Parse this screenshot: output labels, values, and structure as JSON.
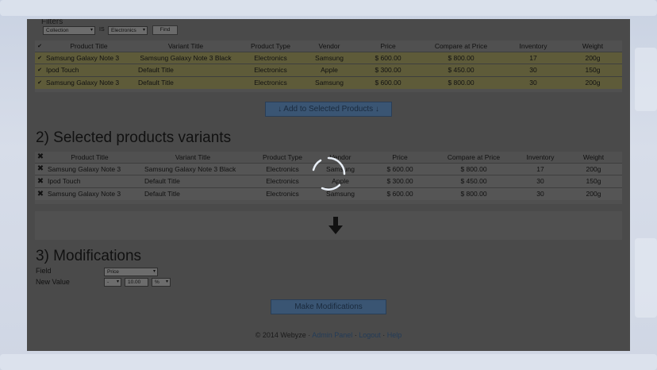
{
  "filters": {
    "label": "Filters",
    "field_value": "Collection",
    "operator": "IS",
    "value_value": "Electronics",
    "find_label": "Find"
  },
  "search_results": {
    "headers": [
      "Product Title",
      "Variant Title",
      "Product Type",
      "Vendor",
      "Price",
      "Compare at Price",
      "Inventory",
      "Weight"
    ],
    "rows": [
      [
        "Samsung Galaxy Note 3",
        "Samsung Galaxy Note 3 Black",
        "Electronics",
        "Samsung",
        "$ 600.00",
        "$ 800.00",
        "17",
        "200g"
      ],
      [
        "Ipod Touch",
        "Default Title",
        "Electronics",
        "Apple",
        "$ 300.00",
        "$ 450.00",
        "30",
        "150g"
      ],
      [
        "Samsung Galaxy Note 3",
        "Default Title",
        "Electronics",
        "Samsung",
        "$ 600.00",
        "$ 800.00",
        "30",
        "200g"
      ]
    ]
  },
  "add_button_label": "↓ Add to Selected Products ↓",
  "section2": {
    "title": "2) Selected products variants",
    "headers": [
      "Product Title",
      "Variant Title",
      "Product Type",
      "Vendor",
      "Price",
      "Compare at Price",
      "Inventory",
      "Weight"
    ],
    "rows": [
      [
        "Samsung Galaxy Note 3",
        "Samsung Galaxy Note 3 Black",
        "Electronics",
        "Samsung",
        "$ 600.00",
        "$ 800.00",
        "17",
        "200g"
      ],
      [
        "Ipod Touch",
        "Default Title",
        "Electronics",
        "Apple",
        "$ 300.00",
        "$ 450.00",
        "30",
        "150g"
      ],
      [
        "Samsung Galaxy Note 3",
        "Default Title",
        "Electronics",
        "Samsung",
        "$ 600.00",
        "$ 800.00",
        "30",
        "200g"
      ]
    ]
  },
  "section3": {
    "title": "3) Modifications",
    "field_label": "Field",
    "field_value": "Price",
    "new_value_label": "New Value",
    "op_value": "-",
    "amount_value": "10.00",
    "unit_value": "%",
    "make_button_label": "Make Modifications"
  },
  "footer": {
    "copyright": "© 2014 Webyze · ",
    "admin_panel": "Admin Panel",
    "sep1": " · ",
    "logout": "Logout",
    "sep2": " · ",
    "help": "Help"
  },
  "colors": {
    "overlay": "#4a4a4a",
    "highlight_row": "#5e5b39",
    "button": "#3a5573",
    "link": "#233b57"
  },
  "icons": {
    "checkbox": "check-icon",
    "remove": "x-icon",
    "arrow": "arrow-down-icon",
    "loading": "spinner-icon"
  }
}
